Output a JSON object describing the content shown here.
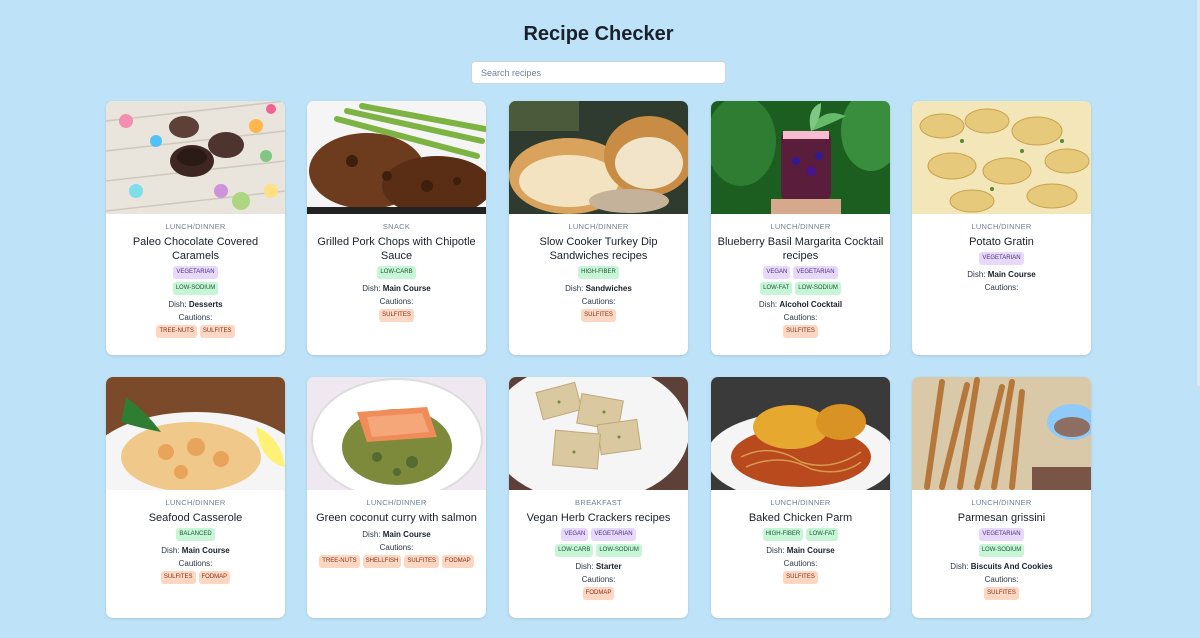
{
  "title": "Recipe Checker",
  "search": {
    "placeholder": "Search recipes",
    "value": ""
  },
  "labels": {
    "dish_prefix": "Dish: ",
    "cautions": "Cautions:"
  },
  "colors": {
    "background": "#bee3f8",
    "diet_tag": "#c6f6d5",
    "health_tag": "#e9d8fd",
    "caution_tag": "#fed7c3"
  },
  "recipes": [
    {
      "image": "chocolate-cups-photo",
      "meal": "LUNCH/DINNER",
      "name": "Paleo Chocolate Covered Caramels",
      "diet": [],
      "health": [
        "VEGETARIAN"
      ],
      "health2": [
        "LOW-SODIUM"
      ],
      "dish": "Desserts",
      "cautions": [
        "TREE-NUTS",
        "SULFITES"
      ]
    },
    {
      "image": "pork-chops-photo",
      "meal": "SNACK",
      "name": "Grilled Pork Chops with Chipotle Sauce",
      "diet": [
        "LOW-CARB"
      ],
      "health": [],
      "health2": [],
      "dish": "Main Course",
      "cautions": [
        "SULFITES"
      ]
    },
    {
      "image": "turkey-sandwich-photo",
      "meal": "LUNCH/DINNER",
      "name": "Slow Cooker Turkey Dip Sandwiches recipes",
      "diet": [
        "HIGH-FIBER"
      ],
      "health": [],
      "health2": [],
      "dish": "Sandwiches",
      "cautions": [
        "SULFITES"
      ]
    },
    {
      "image": "margarita-photo",
      "meal": "LUNCH/DINNER",
      "name": "Blueberry Basil Margarita Cocktail recipes",
      "diet": [],
      "health": [
        "VEGAN",
        "VEGETARIAN"
      ],
      "health2": [
        "LOW-FAT",
        "LOW-SODIUM"
      ],
      "dish": "Alcohol Cocktail",
      "cautions": [
        "SULFITES"
      ]
    },
    {
      "image": "potato-gratin-photo",
      "meal": "LUNCH/DINNER",
      "name": "Potato Gratin",
      "diet": [],
      "health": [
        "VEGETARIAN"
      ],
      "health2": [],
      "dish": "Main Course",
      "cautions": []
    },
    {
      "image": "seafood-casserole-photo",
      "meal": "LUNCH/DINNER",
      "name": "Seafood Casserole",
      "diet": [
        "BALANCED"
      ],
      "health": [],
      "health2": [],
      "dish": "Main Course",
      "cautions": [
        "SULFITES",
        "FODMAP"
      ]
    },
    {
      "image": "salmon-curry-photo",
      "meal": "LUNCH/DINNER",
      "name": "Green coconut curry with salmon",
      "diet": [],
      "health": [],
      "health2": [],
      "dish": "Main Course",
      "cautions": [
        "TREE-NUTS",
        "SHELLFISH",
        "SULFITES",
        "FODMAP"
      ]
    },
    {
      "image": "herb-crackers-photo",
      "meal": "BREAKFAST",
      "name": "Vegan Herb Crackers recipes",
      "diet": [],
      "health": [
        "VEGAN",
        "VEGETARIAN"
      ],
      "health2": [
        "LOW-CARB",
        "LOW-SODIUM"
      ],
      "dish": "Starter",
      "cautions": [
        "FODMAP"
      ]
    },
    {
      "image": "chicken-parm-photo",
      "meal": "LUNCH/DINNER",
      "name": "Baked Chicken Parm",
      "diet": [
        "HIGH-FIBER",
        "LOW-FAT"
      ],
      "health": [],
      "health2": [],
      "dish": "Main Course",
      "cautions": [
        "SULFITES"
      ]
    },
    {
      "image": "grissini-photo",
      "meal": "LUNCH/DINNER",
      "name": "Parmesan grissini",
      "diet": [],
      "health": [
        "VEGETARIAN"
      ],
      "health2": [
        "LOW-SODIUM"
      ],
      "dish": "Biscuits And Cookies",
      "cautions": [
        "SULFITES"
      ]
    }
  ]
}
